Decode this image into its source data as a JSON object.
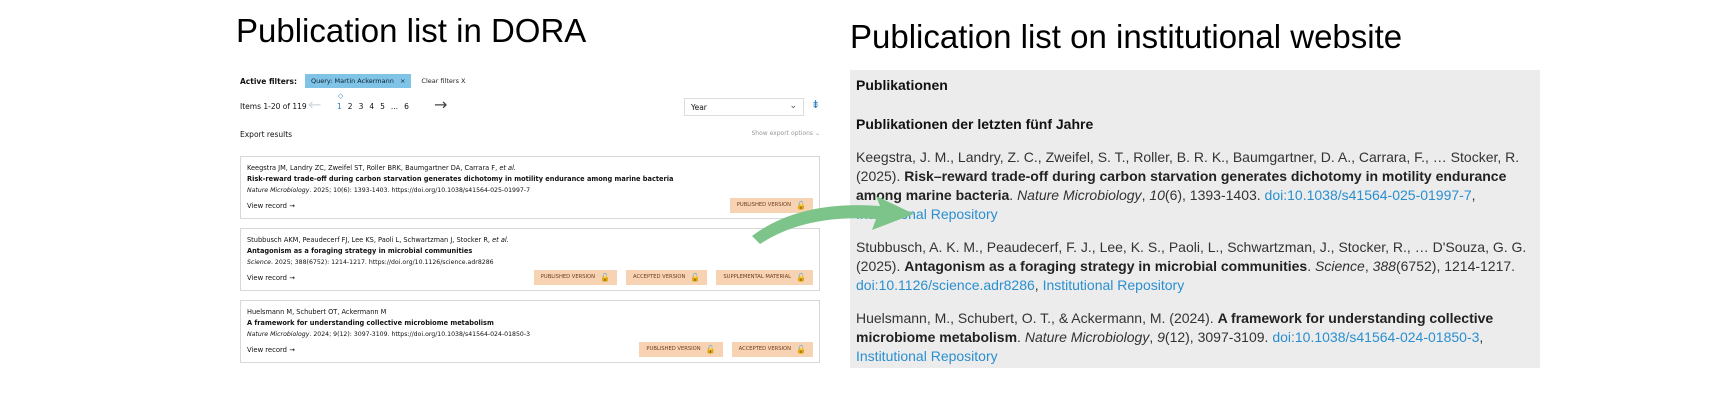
{
  "headings": {
    "left": "Publication list in DORA",
    "right": "Publication list on institutional website"
  },
  "dora": {
    "active_filters_label": "Active filters:",
    "filter_chip": "Query: Martin Ackermann",
    "filter_chip_close": "×",
    "clear_filters": "Clear filters X",
    "items_count": "Items 1-20 of 119",
    "pages": [
      "1",
      "2",
      "3",
      "4",
      "5",
      "...",
      "6"
    ],
    "page_marker": "◇",
    "prev_arrow": "←",
    "next_arrow": "→",
    "year_select": "Year",
    "year_chevron": "⌄",
    "sort_icon": "⇟",
    "export_results": "Export results",
    "show_export_options": "Show export options",
    "export_chevron": "⌄",
    "records": [
      {
        "authors": "Keegstra JM, Landry ZC, Zweifel ST, Roller BRK, Baumgartner DA, Carrara F,",
        "et_al": "et al.",
        "title": "Risk-reward trade-off during carbon starvation generates dichotomy in motility endurance among marine bacteria",
        "journal": "Nature Microbiology",
        "cite_rest": ". 2025; 10(6): 1393-1403. https://doi.org/10.1038/s41564-025-01997-7",
        "view": "View record",
        "badges": [
          "PUBLISHED VERSION"
        ]
      },
      {
        "authors": "Stubbusch AKM, Peaudecerf FJ, Lee KS, Paoli L, Schwartzman J, Stocker R,",
        "et_al": "et al.",
        "title": "Antagonism as a foraging strategy in microbial communities",
        "journal": "Science",
        "cite_rest": ". 2025; 388(6752): 1214-1217. https://doi.org/10.1126/science.adr8286",
        "view": "View record",
        "badges": [
          "PUBLISHED VERSION",
          "ACCEPTED VERSION",
          "SUPPLEMENTAL MATERIAL"
        ]
      },
      {
        "authors": "Huelsmann M, Schubert OT, Ackermann M",
        "et_al": "",
        "title": "A framework for understanding collective microbiome metabolism",
        "journal": "Nature Microbiology",
        "cite_rest": ". 2024; 9(12): 3097-3109. https://doi.org/10.1038/s41564-024-01850-3",
        "view": "View record",
        "badges": [
          "PUBLISHED VERSION",
          "ACCEPTED VERSION"
        ]
      }
    ],
    "view_arrow": "→",
    "lock_icon": "🔓"
  },
  "inst": {
    "h1": "Publikationen",
    "h2": "Publikationen der letzten fünf Jahre",
    "entries": [
      {
        "authors": "Keegstra, J. M., Landry, Z. C., Zweifel, S. T., Roller, B. R. K., Baumgartner, D. A., Carrara, F., … Stocker, R. (2025).",
        "title": "Risk–reward trade-off during carbon starvation generates dichotomy in motility endurance among marine bacteria",
        "journal": "Nature Microbiology",
        "volume": "10",
        "rest": "(6), 1393-1403.",
        "doi": "doi:10.1038/s41564-025-01997-7",
        "repo": "Institutional Repository"
      },
      {
        "authors": "Stubbusch, A. K. M., Peaudecerf, F. J., Lee, K. S., Paoli, L., Schwartzman, J., Stocker, R., … D'Souza, G. G. (2025).",
        "title": "Antagonism as a foraging strategy in microbial communities",
        "journal": "Science",
        "volume": "388",
        "rest": "(6752), 1214-1217.",
        "doi": "doi:10.1126/science.adr8286",
        "repo": "Institutional Repository"
      },
      {
        "authors": "Huelsmann, M., Schubert, O. T., & Ackermann, M. (2024).",
        "title": "A framework for understanding collective microbiome metabolism",
        "journal": "Nature Microbiology",
        "volume": "9",
        "rest": "(12), 3097-3109.",
        "doi": "doi:10.1038/s41564-024-01850-3",
        "repo": "Institutional Repository"
      }
    ]
  },
  "colors": {
    "arrow": "#7cc48a",
    "chip": "#7fc4e6",
    "badge": "#f7d3b3",
    "link": "#2a8fd0"
  }
}
